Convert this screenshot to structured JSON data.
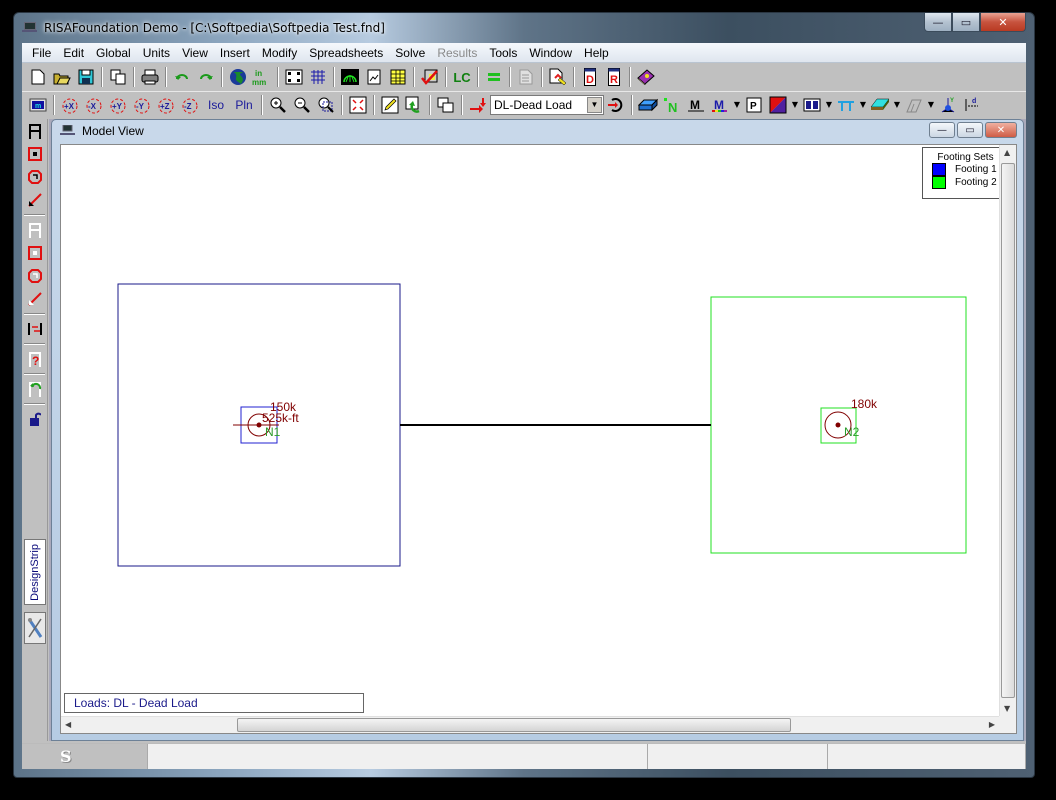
{
  "window": {
    "title": "RISAFoundation Demo - [C:\\Softpedia\\Softpedia Test.fnd]",
    "controls": {
      "minimize": "—",
      "restore": "▭",
      "close": "✕"
    }
  },
  "menubar": {
    "items": [
      {
        "label": "File",
        "enabled": true
      },
      {
        "label": "Edit",
        "enabled": true
      },
      {
        "label": "Global",
        "enabled": true
      },
      {
        "label": "Units",
        "enabled": true
      },
      {
        "label": "View",
        "enabled": true
      },
      {
        "label": "Insert",
        "enabled": true
      },
      {
        "label": "Modify",
        "enabled": true
      },
      {
        "label": "Spreadsheets",
        "enabled": true
      },
      {
        "label": "Solve",
        "enabled": true
      },
      {
        "label": "Results",
        "enabled": false
      },
      {
        "label": "Tools",
        "enabled": true
      },
      {
        "label": "Window",
        "enabled": true
      },
      {
        "label": "Help",
        "enabled": true
      }
    ]
  },
  "toolbar1": {
    "buttons": [
      "new-file",
      "open-file",
      "save",
      "copy",
      "print",
      "undo",
      "redo",
      "global-parameters",
      "units",
      "drawing-grid",
      "project-grid",
      "solve-results",
      "page-view",
      "spreadsheet",
      "check-model",
      "load-combinations",
      "equal",
      "report-disabled",
      "edit-report",
      "design-d",
      "design-r",
      "help-book"
    ],
    "lc_label": "LC",
    "eq_label": "="
  },
  "toolbar2": {
    "view_buttons": [
      {
        "name": "rotate-plus-x",
        "label": "+X"
      },
      {
        "name": "rotate-minus-x",
        "label": "-X"
      },
      {
        "name": "rotate-plus-y",
        "label": "+Y"
      },
      {
        "name": "rotate-minus-y",
        "label": "-Y"
      },
      {
        "name": "rotate-plus-z",
        "label": "+Z"
      },
      {
        "name": "rotate-minus-z",
        "label": "-Z"
      }
    ],
    "iso_label": "Iso",
    "pln_label": "Pln",
    "load_case_select": {
      "value": "DL-Dead Load"
    }
  },
  "left_toolbar": {
    "design_strip_label": "DesignStrip"
  },
  "model_view": {
    "title": "Model View",
    "legend": {
      "title": "Footing Sets",
      "items": [
        {
          "label": "Footing 1",
          "color": "#0000ff"
        },
        {
          "label": "Footing 2",
          "color": "#00ff00"
        }
      ]
    },
    "footings": [
      {
        "node": "N1",
        "color": "#0000ff",
        "loads": [
          "150k",
          "525k-ft"
        ]
      },
      {
        "node": "N2",
        "color": "#00ff00",
        "loads": [
          "180k"
        ]
      }
    ],
    "load_color": "#800000",
    "node_label_color": "#2a9a2a",
    "loads_label": "Loads: DL - Dead Load"
  },
  "statusbar": {
    "cells": [
      "S",
      "",
      "",
      ""
    ]
  }
}
